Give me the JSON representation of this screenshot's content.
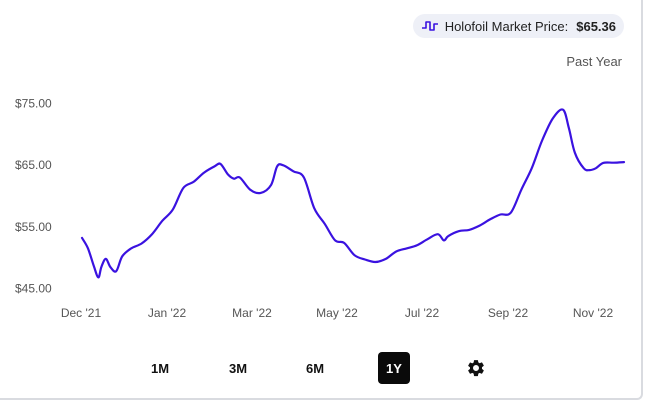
{
  "price_badge": {
    "icon": "sparkline-icon",
    "label": "Holofoil Market Price:",
    "value": "$65.36"
  },
  "range_label": "Past Year",
  "range_buttons": [
    {
      "label": "1M",
      "active": false
    },
    {
      "label": "3M",
      "active": false
    },
    {
      "label": "6M",
      "active": false
    },
    {
      "label": "1Y",
      "active": true
    }
  ],
  "settings_icon": "gear-icon",
  "colors": {
    "line": "#3a12e0",
    "active_button": "#0a0a0a",
    "badge_bg": "#eef0f7"
  },
  "chart_data": {
    "type": "line",
    "title": "",
    "xlabel": "",
    "ylabel": "",
    "x_ticks": [
      "Dec '21",
      "Jan '22",
      "Mar '22",
      "May '22",
      "Jul '22",
      "Sep '22",
      "Nov '22"
    ],
    "y_ticks": [
      "$45.00",
      "$55.00",
      "$65.00",
      "$75.00"
    ],
    "ylim": [
      45,
      75
    ],
    "grid": false,
    "legend": "none",
    "series": [
      {
        "name": "Holofoil Market Price",
        "x": [
          "2021-12-01",
          "2021-12-05",
          "2021-12-09",
          "2021-12-12",
          "2021-12-14",
          "2021-12-17",
          "2021-12-20",
          "2021-12-24",
          "2021-12-28",
          "2022-01-03",
          "2022-01-10",
          "2022-01-17",
          "2022-01-24",
          "2022-01-31",
          "2022-02-07",
          "2022-02-14",
          "2022-02-21",
          "2022-02-28",
          "2022-03-04",
          "2022-03-09",
          "2022-03-13",
          "2022-03-17",
          "2022-03-24",
          "2022-03-31",
          "2022-04-07",
          "2022-04-11",
          "2022-04-15",
          "2022-04-22",
          "2022-04-29",
          "2022-05-06",
          "2022-05-13",
          "2022-05-20",
          "2022-05-26",
          "2022-06-02",
          "2022-06-09",
          "2022-06-16",
          "2022-06-23",
          "2022-06-30",
          "2022-07-07",
          "2022-07-14",
          "2022-07-21",
          "2022-07-28",
          "2022-08-01",
          "2022-08-04",
          "2022-08-11",
          "2022-08-18",
          "2022-08-25",
          "2022-09-01",
          "2022-09-08",
          "2022-09-15",
          "2022-09-22",
          "2022-09-29",
          "2022-10-06",
          "2022-10-13",
          "2022-10-20",
          "2022-10-24",
          "2022-10-28",
          "2022-11-03",
          "2022-11-07",
          "2022-11-11",
          "2022-11-16",
          "2022-11-23",
          "2022-11-30"
        ],
        "y": [
          53.2,
          51.5,
          48.6,
          46.8,
          48.5,
          49.8,
          48.5,
          47.8,
          50.2,
          51.5,
          52.3,
          53.8,
          56.0,
          57.8,
          61.3,
          62.3,
          63.8,
          64.8,
          65.2,
          63.5,
          62.8,
          63.0,
          61.0,
          60.5,
          61.8,
          64.8,
          65.0,
          64.0,
          63.0,
          58.0,
          55.5,
          52.8,
          52.4,
          50.4,
          49.7,
          49.3,
          49.8,
          51.0,
          51.5,
          52.0,
          53.0,
          53.8,
          52.8,
          53.5,
          54.3,
          54.5,
          55.2,
          56.2,
          57.0,
          57.3,
          61.0,
          64.5,
          69.0,
          72.5,
          74.0,
          71.0,
          67.0,
          64.5,
          64.2,
          64.5,
          65.36,
          65.4,
          65.5
        ]
      }
    ]
  }
}
